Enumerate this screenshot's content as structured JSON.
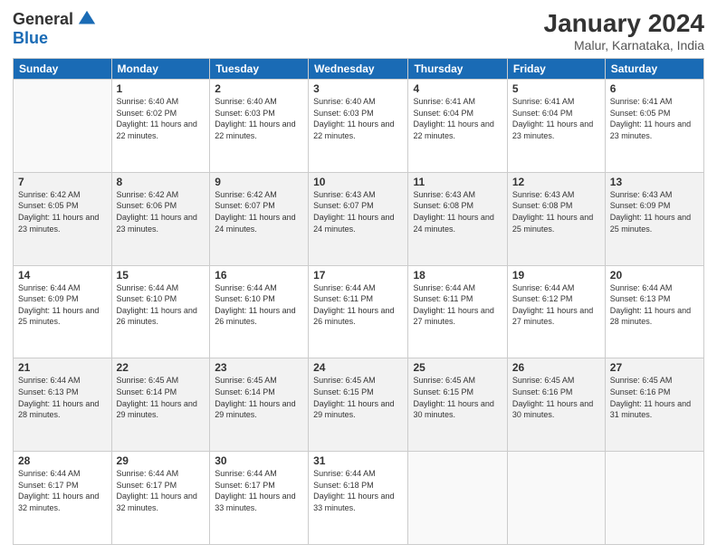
{
  "logo": {
    "general": "General",
    "blue": "Blue"
  },
  "header": {
    "month": "January 2024",
    "location": "Malur, Karnataka, India"
  },
  "days_of_week": [
    "Sunday",
    "Monday",
    "Tuesday",
    "Wednesday",
    "Thursday",
    "Friday",
    "Saturday"
  ],
  "weeks": [
    [
      {
        "day": "",
        "sunrise": "",
        "sunset": "",
        "daylight": ""
      },
      {
        "day": "1",
        "sunrise": "Sunrise: 6:40 AM",
        "sunset": "Sunset: 6:02 PM",
        "daylight": "Daylight: 11 hours and 22 minutes."
      },
      {
        "day": "2",
        "sunrise": "Sunrise: 6:40 AM",
        "sunset": "Sunset: 6:03 PM",
        "daylight": "Daylight: 11 hours and 22 minutes."
      },
      {
        "day": "3",
        "sunrise": "Sunrise: 6:40 AM",
        "sunset": "Sunset: 6:03 PM",
        "daylight": "Daylight: 11 hours and 22 minutes."
      },
      {
        "day": "4",
        "sunrise": "Sunrise: 6:41 AM",
        "sunset": "Sunset: 6:04 PM",
        "daylight": "Daylight: 11 hours and 22 minutes."
      },
      {
        "day": "5",
        "sunrise": "Sunrise: 6:41 AM",
        "sunset": "Sunset: 6:04 PM",
        "daylight": "Daylight: 11 hours and 23 minutes."
      },
      {
        "day": "6",
        "sunrise": "Sunrise: 6:41 AM",
        "sunset": "Sunset: 6:05 PM",
        "daylight": "Daylight: 11 hours and 23 minutes."
      }
    ],
    [
      {
        "day": "7",
        "sunrise": "Sunrise: 6:42 AM",
        "sunset": "Sunset: 6:05 PM",
        "daylight": "Daylight: 11 hours and 23 minutes."
      },
      {
        "day": "8",
        "sunrise": "Sunrise: 6:42 AM",
        "sunset": "Sunset: 6:06 PM",
        "daylight": "Daylight: 11 hours and 23 minutes."
      },
      {
        "day": "9",
        "sunrise": "Sunrise: 6:42 AM",
        "sunset": "Sunset: 6:07 PM",
        "daylight": "Daylight: 11 hours and 24 minutes."
      },
      {
        "day": "10",
        "sunrise": "Sunrise: 6:43 AM",
        "sunset": "Sunset: 6:07 PM",
        "daylight": "Daylight: 11 hours and 24 minutes."
      },
      {
        "day": "11",
        "sunrise": "Sunrise: 6:43 AM",
        "sunset": "Sunset: 6:08 PM",
        "daylight": "Daylight: 11 hours and 24 minutes."
      },
      {
        "day": "12",
        "sunrise": "Sunrise: 6:43 AM",
        "sunset": "Sunset: 6:08 PM",
        "daylight": "Daylight: 11 hours and 25 minutes."
      },
      {
        "day": "13",
        "sunrise": "Sunrise: 6:43 AM",
        "sunset": "Sunset: 6:09 PM",
        "daylight": "Daylight: 11 hours and 25 minutes."
      }
    ],
    [
      {
        "day": "14",
        "sunrise": "Sunrise: 6:44 AM",
        "sunset": "Sunset: 6:09 PM",
        "daylight": "Daylight: 11 hours and 25 minutes."
      },
      {
        "day": "15",
        "sunrise": "Sunrise: 6:44 AM",
        "sunset": "Sunset: 6:10 PM",
        "daylight": "Daylight: 11 hours and 26 minutes."
      },
      {
        "day": "16",
        "sunrise": "Sunrise: 6:44 AM",
        "sunset": "Sunset: 6:10 PM",
        "daylight": "Daylight: 11 hours and 26 minutes."
      },
      {
        "day": "17",
        "sunrise": "Sunrise: 6:44 AM",
        "sunset": "Sunset: 6:11 PM",
        "daylight": "Daylight: 11 hours and 26 minutes."
      },
      {
        "day": "18",
        "sunrise": "Sunrise: 6:44 AM",
        "sunset": "Sunset: 6:11 PM",
        "daylight": "Daylight: 11 hours and 27 minutes."
      },
      {
        "day": "19",
        "sunrise": "Sunrise: 6:44 AM",
        "sunset": "Sunset: 6:12 PM",
        "daylight": "Daylight: 11 hours and 27 minutes."
      },
      {
        "day": "20",
        "sunrise": "Sunrise: 6:44 AM",
        "sunset": "Sunset: 6:13 PM",
        "daylight": "Daylight: 11 hours and 28 minutes."
      }
    ],
    [
      {
        "day": "21",
        "sunrise": "Sunrise: 6:44 AM",
        "sunset": "Sunset: 6:13 PM",
        "daylight": "Daylight: 11 hours and 28 minutes."
      },
      {
        "day": "22",
        "sunrise": "Sunrise: 6:45 AM",
        "sunset": "Sunset: 6:14 PM",
        "daylight": "Daylight: 11 hours and 29 minutes."
      },
      {
        "day": "23",
        "sunrise": "Sunrise: 6:45 AM",
        "sunset": "Sunset: 6:14 PM",
        "daylight": "Daylight: 11 hours and 29 minutes."
      },
      {
        "day": "24",
        "sunrise": "Sunrise: 6:45 AM",
        "sunset": "Sunset: 6:15 PM",
        "daylight": "Daylight: 11 hours and 29 minutes."
      },
      {
        "day": "25",
        "sunrise": "Sunrise: 6:45 AM",
        "sunset": "Sunset: 6:15 PM",
        "daylight": "Daylight: 11 hours and 30 minutes."
      },
      {
        "day": "26",
        "sunrise": "Sunrise: 6:45 AM",
        "sunset": "Sunset: 6:16 PM",
        "daylight": "Daylight: 11 hours and 30 minutes."
      },
      {
        "day": "27",
        "sunrise": "Sunrise: 6:45 AM",
        "sunset": "Sunset: 6:16 PM",
        "daylight": "Daylight: 11 hours and 31 minutes."
      }
    ],
    [
      {
        "day": "28",
        "sunrise": "Sunrise: 6:44 AM",
        "sunset": "Sunset: 6:17 PM",
        "daylight": "Daylight: 11 hours and 32 minutes."
      },
      {
        "day": "29",
        "sunrise": "Sunrise: 6:44 AM",
        "sunset": "Sunset: 6:17 PM",
        "daylight": "Daylight: 11 hours and 32 minutes."
      },
      {
        "day": "30",
        "sunrise": "Sunrise: 6:44 AM",
        "sunset": "Sunset: 6:17 PM",
        "daylight": "Daylight: 11 hours and 33 minutes."
      },
      {
        "day": "31",
        "sunrise": "Sunrise: 6:44 AM",
        "sunset": "Sunset: 6:18 PM",
        "daylight": "Daylight: 11 hours and 33 minutes."
      },
      {
        "day": "",
        "sunrise": "",
        "sunset": "",
        "daylight": ""
      },
      {
        "day": "",
        "sunrise": "",
        "sunset": "",
        "daylight": ""
      },
      {
        "day": "",
        "sunrise": "",
        "sunset": "",
        "daylight": ""
      }
    ]
  ]
}
